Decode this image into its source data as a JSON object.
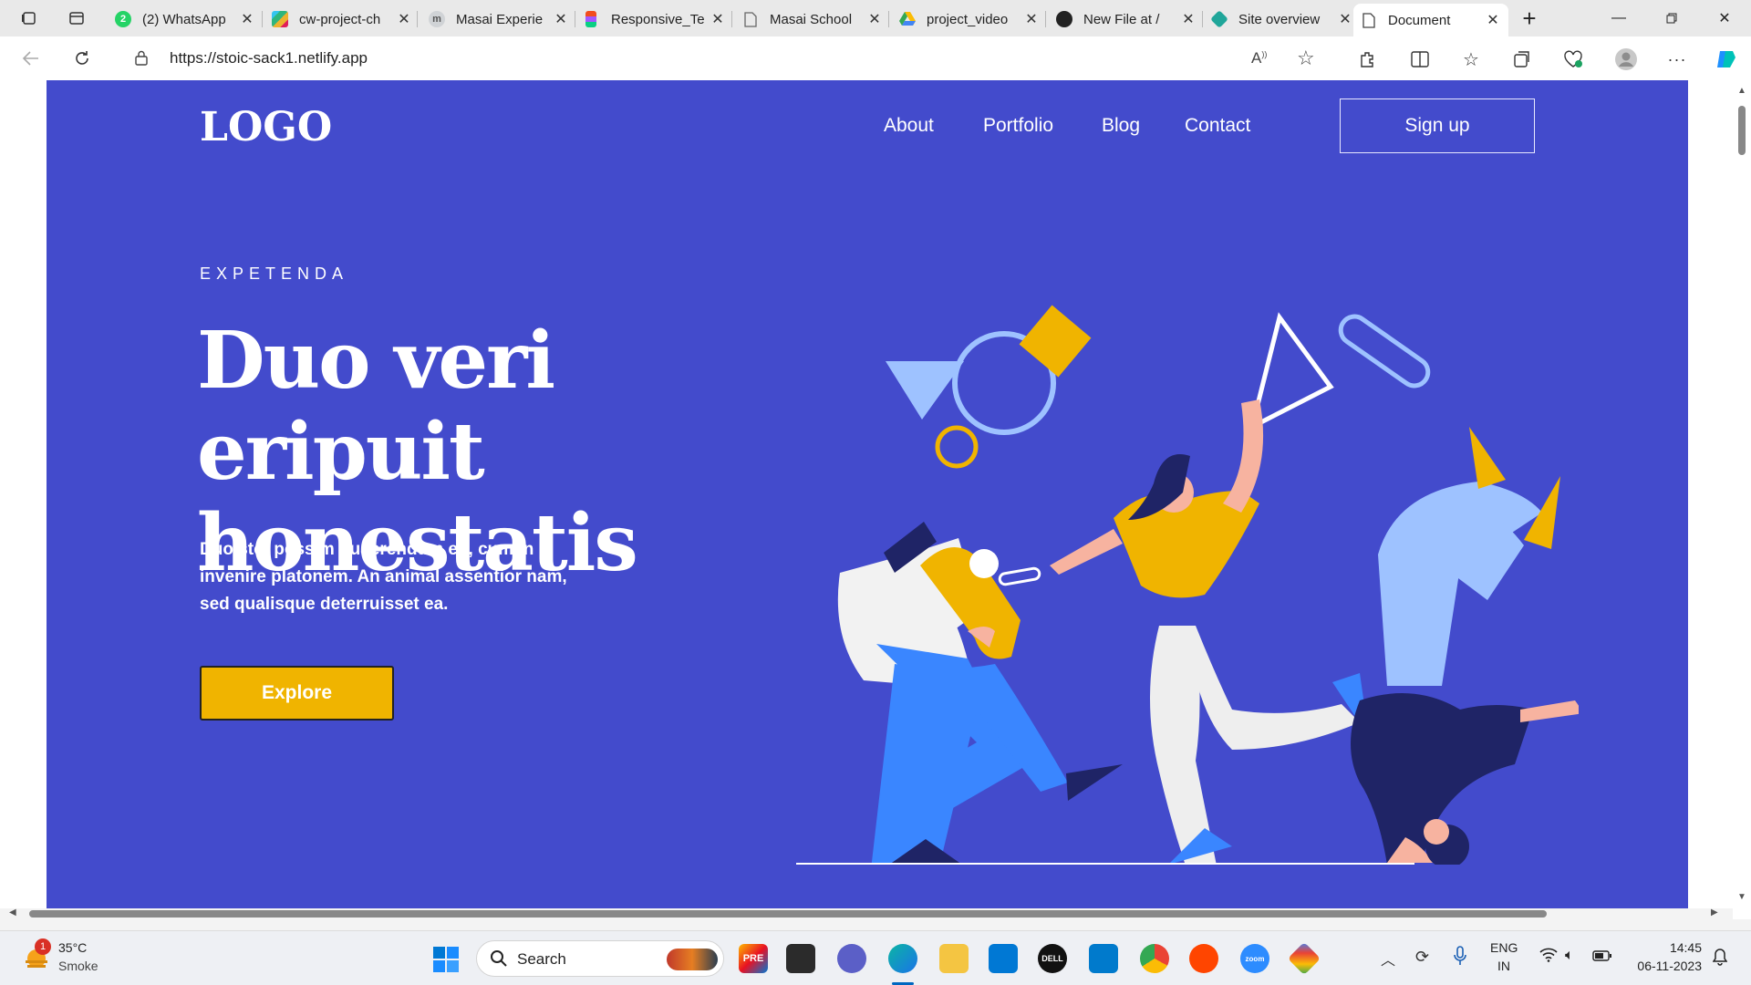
{
  "browser": {
    "tabs": [
      {
        "label": "(2) WhatsApp",
        "icon": "whatsapp-icon",
        "color": "#25d366"
      },
      {
        "label": "cw-project-ch",
        "icon": "slack-icon",
        "color": "#e01e5a"
      },
      {
        "label": "Masai Experie",
        "icon": "masai-icon",
        "color": "#9aa0a6"
      },
      {
        "label": "Responsive_Te",
        "icon": "figma-icon",
        "color": "#f24e1e"
      },
      {
        "label": "Masai School",
        "icon": "document-icon",
        "color": "#888888"
      },
      {
        "label": "project_video",
        "icon": "google-drive-icon",
        "color": "#34a853"
      },
      {
        "label": "New File at /",
        "icon": "github-icon",
        "color": "#222222"
      },
      {
        "label": "Site overview",
        "icon": "netlify-icon",
        "color": "#20a69a"
      },
      {
        "label": "Document",
        "icon": "document-icon",
        "color": "#666666",
        "active": true
      }
    ],
    "url": "https://stoic-sack1.netlify.app"
  },
  "site": {
    "logo": "LOGO",
    "nav": [
      "About",
      "Portfolio",
      "Blog",
      "Contact"
    ],
    "signup_label": "Sign up",
    "kicker": "EXPETENDA",
    "headline_line1": "Duo veri eripuit",
    "headline_line2": "honestatis",
    "subcopy": "Duo stet possim quaerendum eu, cum in invenire platonem. An animal assentior nam, sed qualisque deterruisset ea.",
    "explore_label": "Explore",
    "colors": {
      "background": "#434bcc",
      "accent": "#f0b400",
      "light_blue": "#9ec2ff",
      "blue": "#3a86ff",
      "navy": "#1f2466"
    }
  },
  "taskbar": {
    "weather_temp": "35°C",
    "weather_desc": "Smoke",
    "weather_badge": "1",
    "search_placeholder": "Search",
    "lang_line1": "ENG",
    "lang_line2": "IN",
    "time": "14:45",
    "date": "06-11-2023"
  }
}
